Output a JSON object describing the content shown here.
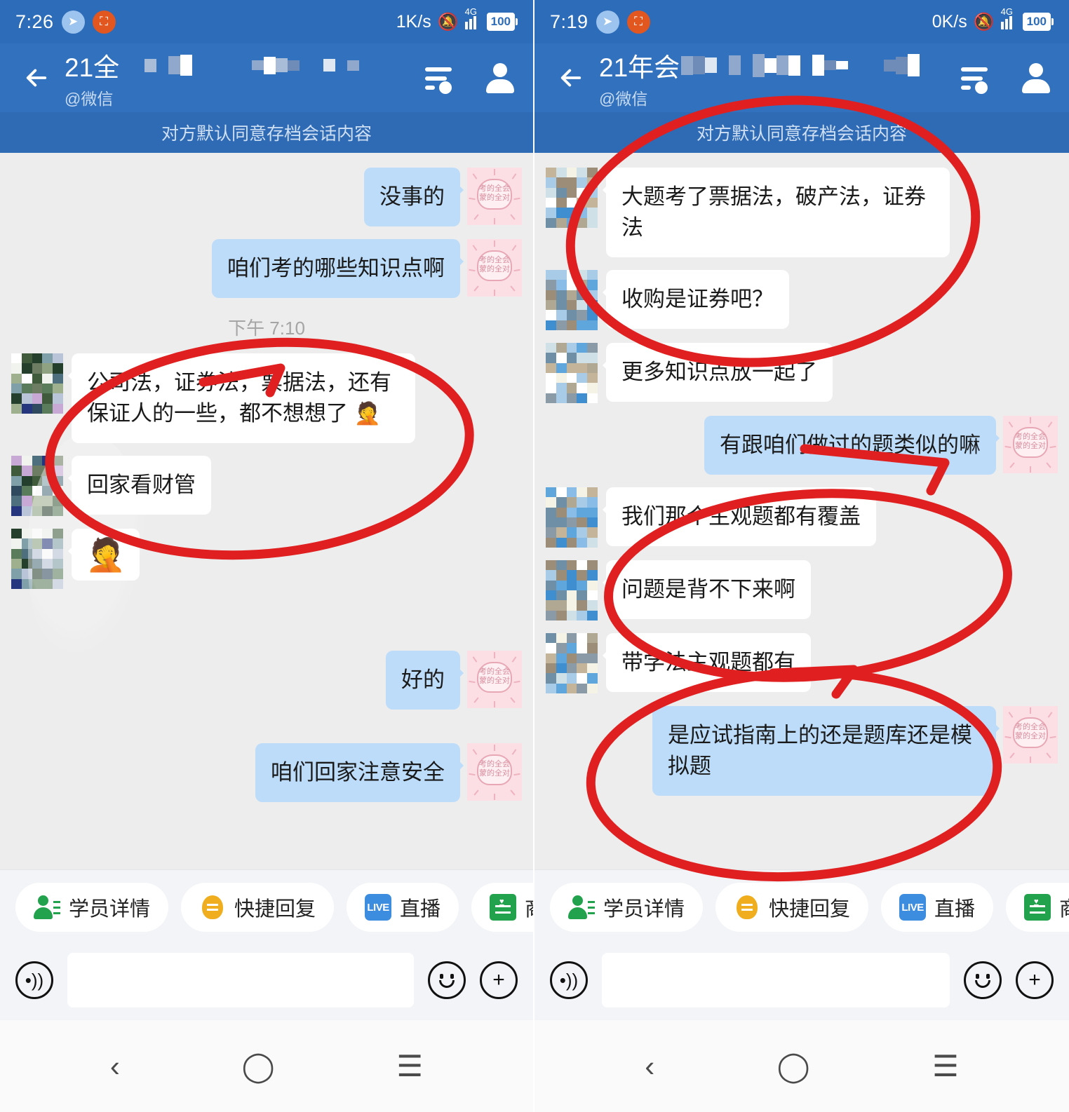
{
  "colors": {
    "status_bar": "#2d6cb8",
    "nav_bar": "#3271bd",
    "archive_banner": "#2f6ab4",
    "chat_background": "#ededed",
    "outgoing_bubble": "#bcdcfa",
    "incoming_bubble": "#ffffff",
    "annotation_red": "#e02020",
    "accent_green": "#22a24c",
    "accent_orange": "#f0ad1e",
    "accent_blue": "#3c8ce0"
  },
  "panels": [
    {
      "id": "left",
      "status_bar": {
        "time": "7:26",
        "network_speed": "1K/s",
        "battery": "100",
        "network_type": "4G",
        "icons": [
          "telegram-icon",
          "screenshot-crop-icon",
          "bell-muted-icon",
          "signal-bars-icon",
          "battery-icon"
        ]
      },
      "nav": {
        "back_label": "←",
        "title": "21全",
        "subtitle": "@微信",
        "filter_icon": "filter-settings-icon",
        "profile_icon": "person-icon"
      },
      "archive_banner": "对方默认同意存档会话内容",
      "timestamp": "下午 7:10",
      "messages": [
        {
          "side": "out",
          "text": "没事的",
          "type": "text"
        },
        {
          "side": "out",
          "text": "咱们考的哪些知识点啊",
          "type": "text"
        },
        {
          "side": "in",
          "text": "公司法，证券法，票据法，还有保证人的一些，都不想想了 🤦",
          "type": "text",
          "highlighted": true
        },
        {
          "side": "in",
          "text": "回家看财管",
          "type": "text"
        },
        {
          "side": "in",
          "text": "🤦",
          "type": "emoji"
        },
        {
          "side": "out",
          "text": "好的",
          "type": "text"
        },
        {
          "side": "out",
          "text": "咱们回家注意安全",
          "type": "text"
        }
      ],
      "quick_actions": [
        {
          "label": "学员详情",
          "icon": "student-detail-icon"
        },
        {
          "label": "快捷回复",
          "icon": "quick-reply-icon"
        },
        {
          "label": "直播",
          "icon": "live-icon",
          "icon_text": "LIVE"
        },
        {
          "label": "商品图册",
          "icon": "product-catalog-icon"
        }
      ],
      "input": {
        "placeholder": "",
        "value": "",
        "voice_icon": "voice-icon",
        "emoji_icon": "smiley-icon",
        "plus_icon": "plus-icon"
      },
      "sysnav": {
        "back": "‹",
        "home": "◯",
        "recents": "☰"
      }
    },
    {
      "id": "right",
      "status_bar": {
        "time": "7:19",
        "network_speed": "0K/s",
        "battery": "100",
        "network_type": "4G",
        "icons": [
          "telegram-icon",
          "screenshot-crop-icon",
          "bell-muted-icon",
          "signal-bars-icon",
          "battery-icon"
        ]
      },
      "nav": {
        "back_label": "←",
        "title": "21年会",
        "subtitle": "@微信",
        "filter_icon": "filter-settings-icon",
        "profile_icon": "person-icon"
      },
      "archive_banner": "对方默认同意存档会话内容",
      "timestamp": "",
      "messages": [
        {
          "side": "in",
          "text": "大题考了票据法，破产法，证券法",
          "type": "text",
          "highlighted": true
        },
        {
          "side": "in",
          "text": "收购是证券吧？",
          "type": "text",
          "highlighted": true
        },
        {
          "side": "in",
          "text": "更多知识点放一起了",
          "type": "text"
        },
        {
          "side": "out",
          "text": "有跟咱们做过的题类似的嘛",
          "type": "text"
        },
        {
          "side": "in",
          "text": "我们那个主观题都有覆盖",
          "type": "text",
          "highlighted": true
        },
        {
          "side": "in",
          "text": "问题是背不下来啊",
          "type": "text"
        },
        {
          "side": "in",
          "text": "带学法主观题都有",
          "type": "text",
          "highlighted": true
        },
        {
          "side": "out",
          "text": "是应试指南上的还是题库还是模拟题",
          "type": "text",
          "highlighted": true
        }
      ],
      "quick_actions": [
        {
          "label": "学员详情",
          "icon": "student-detail-icon"
        },
        {
          "label": "快捷回复",
          "icon": "quick-reply-icon"
        },
        {
          "label": "直播",
          "icon": "live-icon",
          "icon_text": "LIVE"
        },
        {
          "label": "商品图册",
          "icon": "product-catalog-icon"
        }
      ],
      "input": {
        "placeholder": "",
        "value": "",
        "voice_icon": "voice-icon",
        "emoji_icon": "smiley-icon",
        "plus_icon": "plus-icon"
      },
      "sysnav": {
        "back": "‹",
        "home": "◯",
        "recents": "☰"
      }
    }
  ],
  "sticker": {
    "text_line1": "考的全会",
    "text_line2": "蒙的全对",
    "name": "exam-luck-sticker"
  }
}
